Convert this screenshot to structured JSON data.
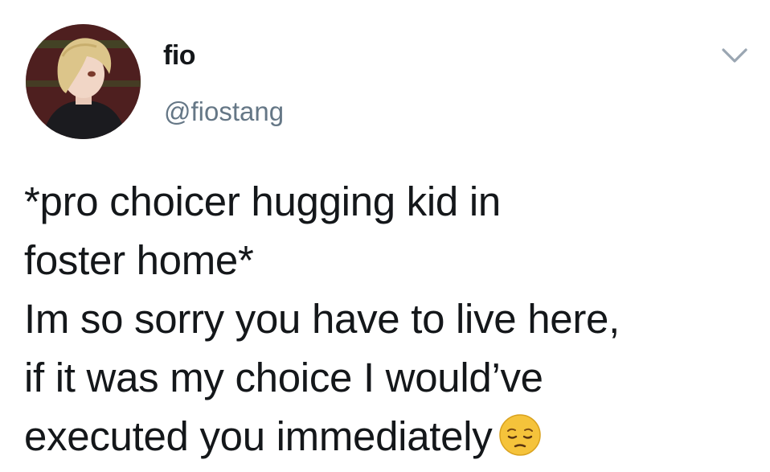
{
  "tweet": {
    "author": {
      "display_name": "fio",
      "handle": "@fiostang"
    },
    "icons": {
      "avatar": "user-avatar",
      "menu": "chevron-down-icon",
      "emoji": "pensive-face-emoji"
    },
    "text_lines": [
      "*pro choicer hugging kid in",
      "foster home*",
      "Im so sorry you have to live here,",
      "if it was my choice I would’ve",
      "executed you immediately"
    ],
    "colors": {
      "text": "#14171a",
      "handle": "#657786",
      "caret": "#9aa6b2",
      "emoji": "#f5c33b"
    }
  }
}
